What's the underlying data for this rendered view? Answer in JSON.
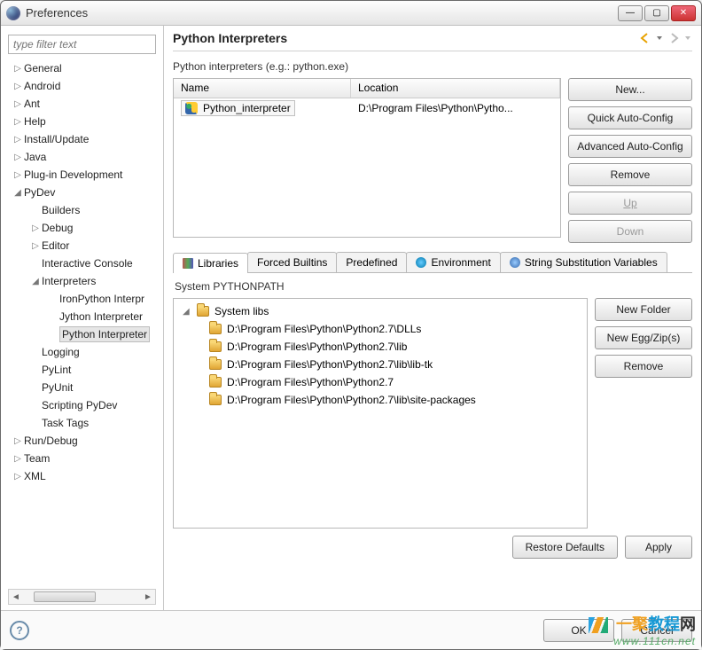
{
  "window": {
    "title": "Preferences"
  },
  "filter": {
    "placeholder": "type filter text"
  },
  "tree": [
    {
      "label": "General",
      "lvl": 1,
      "twisty": "▷"
    },
    {
      "label": "Android",
      "lvl": 1,
      "twisty": "▷"
    },
    {
      "label": "Ant",
      "lvl": 1,
      "twisty": "▷"
    },
    {
      "label": "Help",
      "lvl": 1,
      "twisty": "▷"
    },
    {
      "label": "Install/Update",
      "lvl": 1,
      "twisty": "▷"
    },
    {
      "label": "Java",
      "lvl": 1,
      "twisty": "▷"
    },
    {
      "label": "Plug-in Development",
      "lvl": 1,
      "twisty": "▷"
    },
    {
      "label": "PyDev",
      "lvl": 1,
      "twisty": "◢"
    },
    {
      "label": "Builders",
      "lvl": 2,
      "twisty": ""
    },
    {
      "label": "Debug",
      "lvl": 2,
      "twisty": "▷"
    },
    {
      "label": "Editor",
      "lvl": 2,
      "twisty": "▷"
    },
    {
      "label": "Interactive Console",
      "lvl": 2,
      "twisty": ""
    },
    {
      "label": "Interpreters",
      "lvl": 2,
      "twisty": "◢"
    },
    {
      "label": "IronPython Interpr",
      "lvl": 3,
      "twisty": ""
    },
    {
      "label": "Jython Interpreter",
      "lvl": 3,
      "twisty": ""
    },
    {
      "label": "Python Interpreter",
      "lvl": 3,
      "twisty": "",
      "selected": true
    },
    {
      "label": "Logging",
      "lvl": 2,
      "twisty": ""
    },
    {
      "label": "PyLint",
      "lvl": 2,
      "twisty": ""
    },
    {
      "label": "PyUnit",
      "lvl": 2,
      "twisty": ""
    },
    {
      "label": "Scripting PyDev",
      "lvl": 2,
      "twisty": ""
    },
    {
      "label": "Task Tags",
      "lvl": 2,
      "twisty": ""
    },
    {
      "label": "Run/Debug",
      "lvl": 1,
      "twisty": "▷"
    },
    {
      "label": "Team",
      "lvl": 1,
      "twisty": "▷"
    },
    {
      "label": "XML",
      "lvl": 1,
      "twisty": "▷"
    }
  ],
  "main": {
    "heading": "Python Interpreters",
    "sublabel": "Python interpreters (e.g.: python.exe)",
    "columns": {
      "name": "Name",
      "location": "Location"
    },
    "interpreters": [
      {
        "name": "Python_interpreter",
        "location": "D:\\Program Files\\Python\\Pytho..."
      }
    ],
    "buttons": {
      "new": "New...",
      "quickauto": "Quick Auto-Config",
      "advauto": "Advanced Auto-Config",
      "remove": "Remove",
      "up": "Up",
      "down": "Down"
    },
    "tabs": [
      {
        "label": "Libraries",
        "active": true,
        "icon": "books-icon"
      },
      {
        "label": "Forced Builtins",
        "active": false,
        "icon": ""
      },
      {
        "label": "Predefined",
        "active": false,
        "icon": ""
      },
      {
        "label": "Environment",
        "active": false,
        "icon": "env-icon"
      },
      {
        "label": "String Substitution Variables",
        "active": false,
        "icon": "var-icon"
      }
    ],
    "syslabel": "System PYTHONPATH",
    "systemlibs": {
      "root": "System libs",
      "paths": [
        "D:\\Program Files\\Python\\Python2.7\\DLLs",
        "D:\\Program Files\\Python\\Python2.7\\lib",
        "D:\\Program Files\\Python\\Python2.7\\lib\\lib-tk",
        "D:\\Program Files\\Python\\Python2.7",
        "D:\\Program Files\\Python\\Python2.7\\lib\\site-packages"
      ]
    },
    "libbuttons": {
      "newfolder": "New Folder",
      "newegg": "New Egg/Zip(s)",
      "remove": "Remove"
    },
    "footerbuttons": {
      "restore": "Restore Defaults",
      "apply": "Apply"
    }
  },
  "bottom": {
    "ok": "OK",
    "cancel": "Cancel"
  },
  "watermark": {
    "line1a": "一聚",
    "line1b": "教程",
    "line1c": "网",
    "line2": "www.111cn.net"
  }
}
